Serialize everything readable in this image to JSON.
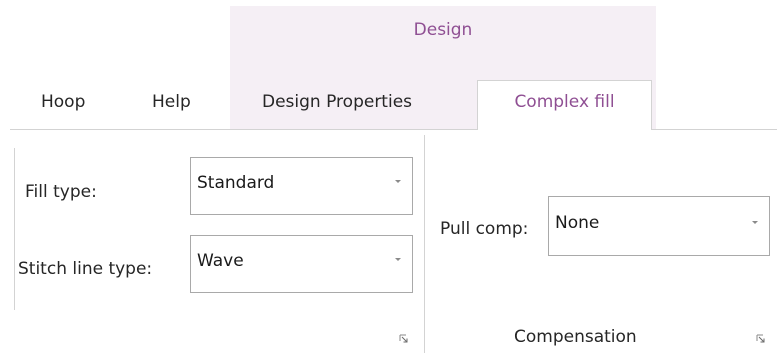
{
  "context_tab_group": {
    "title": "Design"
  },
  "tabs": [
    {
      "label": "Hoop"
    },
    {
      "label": "Help"
    },
    {
      "label": "Design Properties"
    },
    {
      "label": "Complex fill",
      "selected": true
    }
  ],
  "colors": {
    "accent": "#8f4f93",
    "context_band": "#f5eff5",
    "border": "#d3d3d3"
  },
  "fill_group": {
    "fill_type": {
      "label": "Fill type:",
      "value": "Standard"
    },
    "stitch_line_type": {
      "label": "Stitch line type:",
      "value": "Wave"
    },
    "launcher_icon": "dialog-launcher-icon"
  },
  "compensation_group": {
    "label": "Compensation",
    "pull_comp": {
      "label": "Pull comp:",
      "value": "None"
    },
    "launcher_icon": "dialog-launcher-icon"
  }
}
